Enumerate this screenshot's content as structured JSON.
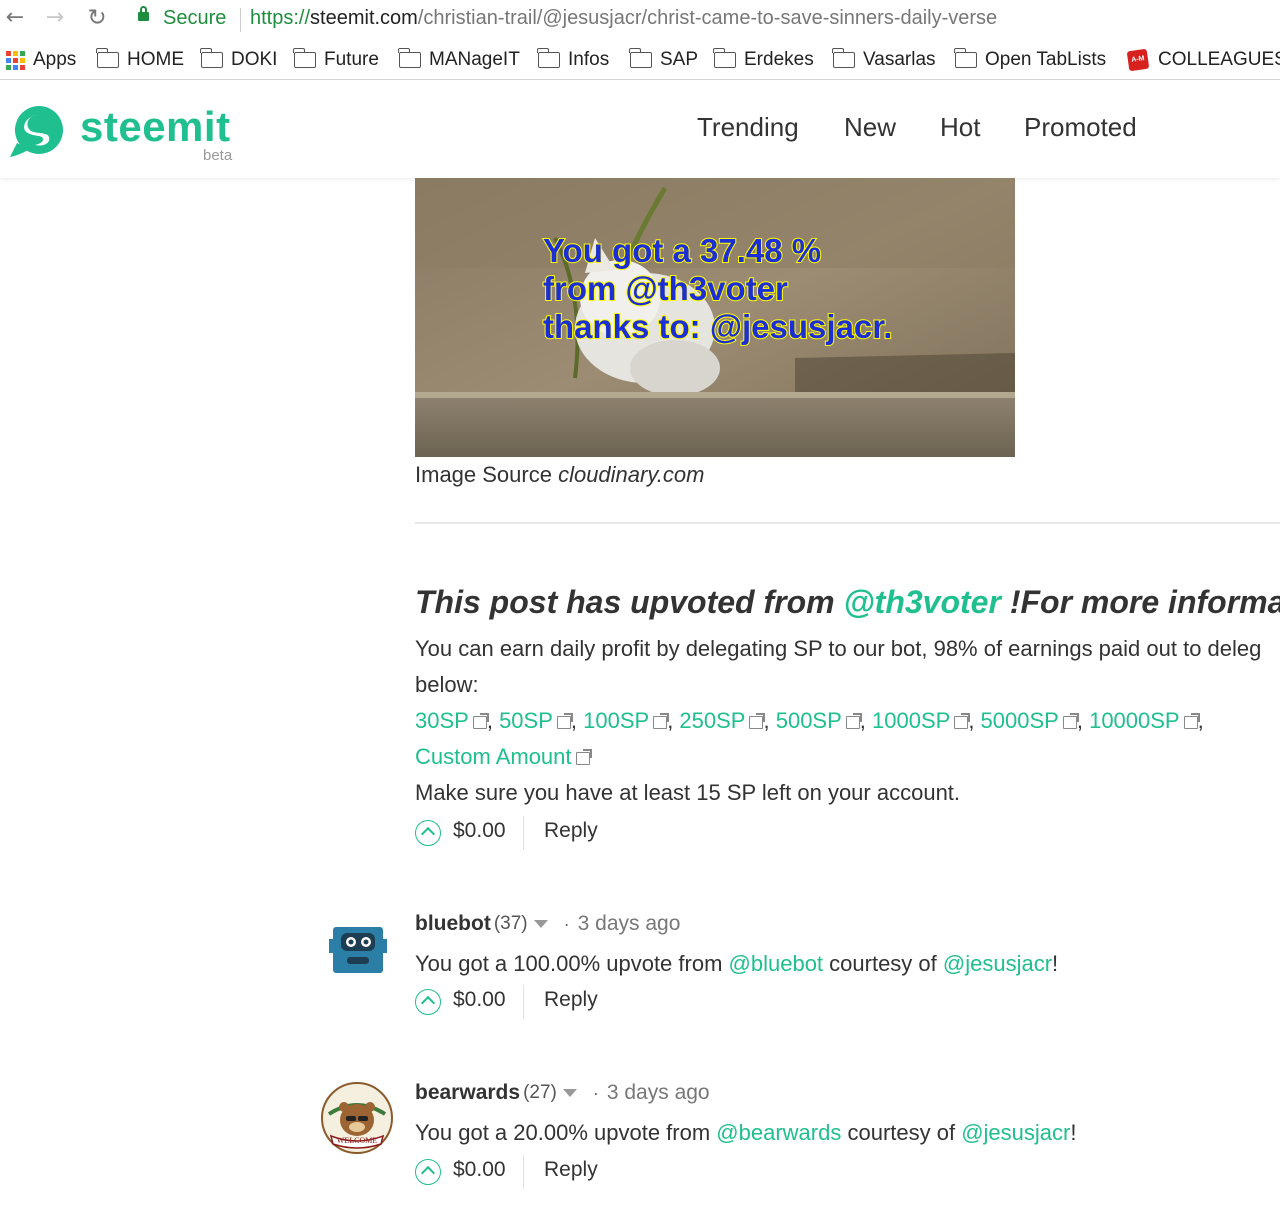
{
  "browser": {
    "secure_label": "Secure",
    "url_scheme": "https://",
    "url_host": "steemit.com",
    "url_path": "/christian-trail/@jesusjacr/christ-came-to-save-sinners-daily-verse",
    "bookmarks": [
      {
        "label": "Apps",
        "icon": "apps-grid-icon"
      },
      {
        "label": "HOME",
        "icon": "folder-icon"
      },
      {
        "label": "DOKI",
        "icon": "folder-icon"
      },
      {
        "label": "Future",
        "icon": "folder-icon"
      },
      {
        "label": "MANageIT",
        "icon": "folder-icon"
      },
      {
        "label": "Infos",
        "icon": "folder-icon"
      },
      {
        "label": "SAP",
        "icon": "folder-icon"
      },
      {
        "label": "Erdekes",
        "icon": "folder-icon"
      },
      {
        "label": "Vasarlas",
        "icon": "folder-icon"
      },
      {
        "label": "Open TabLists",
        "icon": "folder-icon"
      },
      {
        "label": "COLLEAGUES",
        "icon": "am-logo-icon"
      }
    ]
  },
  "site": {
    "logo_text": "steemit",
    "logo_badge": "beta",
    "brand_color": "#1fbf8f",
    "nav": [
      "Trending",
      "New",
      "Hot",
      "Promoted"
    ]
  },
  "post": {
    "image_overlay": {
      "line1": "You got a 37.48 %",
      "line2": "from @th3voter",
      "line3": "thanks to: @jesusjacr."
    },
    "caption_prefix": "Image Source ",
    "caption_source": "cloudinary.com"
  },
  "voter_comment": {
    "heading_prefix": "This post has upvoted from ",
    "heading_link": "@th3voter",
    "heading_suffix": " !For more informatio",
    "line1": "You can earn daily profit by delegating SP to our bot, 98% of earnings paid out to deleg",
    "line2": "below:",
    "delegation_links": [
      "30SP",
      "50SP",
      "100SP",
      "250SP",
      "500SP",
      "1000SP",
      "5000SP",
      "10000SP"
    ],
    "custom_link": "Custom Amount",
    "line4": "Make sure you have at least 15 SP left on your account.",
    "payout": "$0.00",
    "reply_label": "Reply"
  },
  "comments": [
    {
      "author": "bluebot",
      "reputation": "(37)",
      "dot": "·",
      "age": "3 days ago",
      "text_prefix": "You got a 100.00% upvote from ",
      "link1": "@bluebot",
      "text_middle": " courtesy of ",
      "link2": "@jesusjacr",
      "text_suffix": "!",
      "payout": "$0.00",
      "reply_label": "Reply",
      "avatar": "robot-avatar"
    },
    {
      "author": "bearwards",
      "reputation": "(27)",
      "dot": "·",
      "age": "3 days ago",
      "text_prefix": "You got a 20.00% upvote from ",
      "link1": "@bearwards",
      "text_middle": " courtesy of ",
      "link2": "@jesusjacr",
      "text_suffix": "!",
      "payout": "$0.00",
      "reply_label": "Reply",
      "avatar": "bear-welcome-avatar",
      "avatar_badge": "WELCOME"
    }
  ]
}
